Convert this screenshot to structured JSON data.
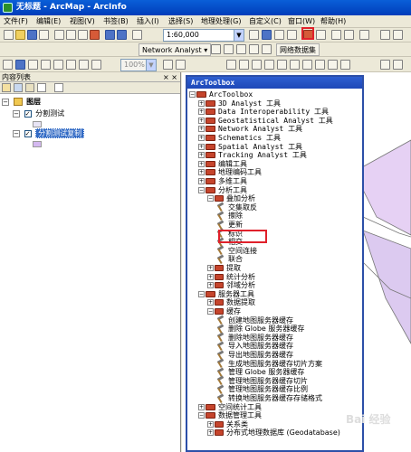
{
  "title": "无标题 - ArcMap - ArcInfo",
  "menu": [
    "文件(F)",
    "编辑(E)",
    "视图(V)",
    "书签(B)",
    "插入(I)",
    "选择(S)",
    "地理处理(G)",
    "自定义(C)",
    "窗口(W)",
    "帮助(H)"
  ],
  "toolbar": {
    "scale": "1:60,000",
    "network_analyst": "Network Analyst ▾",
    "network_dataset": "网络数据集",
    "zoom": "100%"
  },
  "toc": {
    "title": "内容列表",
    "close": "× ×",
    "layers_label": "图层",
    "layer1": "分割测试",
    "layer2": "分割测试复制"
  },
  "arctoolbox": {
    "title": "ArcToolbox",
    "items": [
      "ArcToolbox",
      "3D Analyst 工具",
      "Data Interoperability 工具",
      "Geostatistical Analyst 工具",
      "Network Analyst 工具",
      "Schematics 工具",
      "Spatial Analyst 工具",
      "Tracking Analyst 工具",
      "编辑工具",
      "地理编码工具",
      "多维工具",
      "分析工具",
      "叠加分析",
      "交集取反",
      "擦除",
      "更新",
      "标识",
      "相交",
      "空间连接",
      "联合",
      "提取",
      "统计分析",
      "邻域分析",
      "服务器工具",
      "数据提取",
      "缓存",
      "创建地图服务器缓存",
      "删除 Globe 服务器缓存",
      "删除地图服务器缓存",
      "导入地图服务器缓存",
      "导出地图服务器缓存",
      "生成地图服务器缓存切片方案",
      "管理 Globe 服务器缓存",
      "管理地图服务器缓存切片",
      "管理地图服务器缓存比例",
      "转换地图服务器缓存存储格式",
      "空间统计工具",
      "数据管理工具",
      "关系类",
      "分布式地理数据库 (Geodatabase)"
    ]
  },
  "watermark": "Bai 经验",
  "colors": {
    "title_blue": "#0a5fd8",
    "highlight_red": "#e0212b",
    "toolbox_red": "#c5442c",
    "map_purple": "#e6d1f4"
  }
}
